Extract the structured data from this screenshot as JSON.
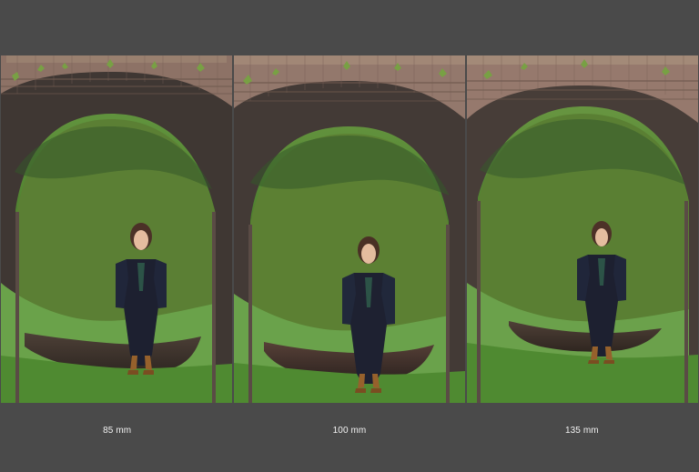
{
  "gallery": {
    "items": [
      {
        "label": "85 mm",
        "tint": "#4c7f30"
      },
      {
        "label": "100 mm",
        "tint": "#507f32"
      },
      {
        "label": "135 mm",
        "tint": "#4d8032"
      }
    ]
  },
  "colors": {
    "page_bg": "#4a4a4a",
    "caption_text": "#f2f2f2"
  }
}
